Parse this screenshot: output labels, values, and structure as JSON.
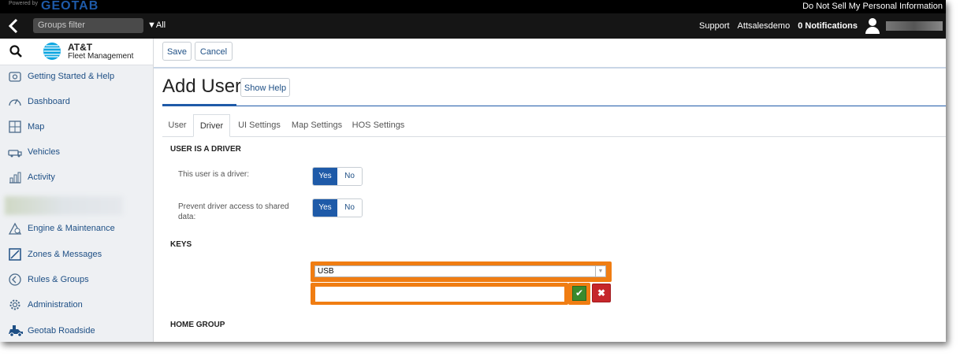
{
  "topbar": {
    "powered_by": "Powered by",
    "brand": "GEOTAB",
    "do_not_sell": "Do Not Sell My Personal Information"
  },
  "navbar": {
    "groups_filter_placeholder": "Groups filter",
    "all_label": "All",
    "support": "Support",
    "account": "Attsalesdemo",
    "notifications": "0 Notifications"
  },
  "sidebar": {
    "logo_line1": "AT&T",
    "logo_line2": "Fleet Management",
    "items": [
      {
        "label": "Getting Started & Help",
        "icon": "help-icon"
      },
      {
        "label": "Dashboard",
        "icon": "gauge-icon"
      },
      {
        "label": "Map",
        "icon": "map-icon"
      },
      {
        "label": "Vehicles",
        "icon": "vehicle-icon"
      },
      {
        "label": "Activity",
        "icon": "activity-icon"
      },
      {
        "label": "Engine & Maintenance",
        "icon": "engine-icon"
      },
      {
        "label": "Zones & Messages",
        "icon": "zones-icon"
      },
      {
        "label": "Rules & Groups",
        "icon": "rules-icon"
      },
      {
        "label": "Administration",
        "icon": "gear-icon"
      },
      {
        "label": "Geotab Roadside",
        "icon": "roadside-icon"
      }
    ]
  },
  "toolbar": {
    "save": "Save",
    "cancel": "Cancel"
  },
  "page": {
    "title": "Add User",
    "show_help": "Show Help"
  },
  "tabs": [
    "User",
    "Driver",
    "UI Settings",
    "Map Settings",
    "HOS Settings"
  ],
  "active_tab": "Driver",
  "driver": {
    "section_title": "USER IS A DRIVER",
    "is_driver_label": "This user is a driver:",
    "is_driver_value": "Yes",
    "prevent_label_line1": "Prevent driver access to shared",
    "prevent_label_line2": "data:",
    "prevent_value": "Yes",
    "yes": "Yes",
    "no": "No"
  },
  "keys": {
    "section_title": "KEYS",
    "type_selected": "USB",
    "key_value": ""
  },
  "home_group": {
    "section_title": "HOME GROUP"
  },
  "colors": {
    "accent": "#1e5aa8",
    "highlight": "#f07d12",
    "ok": "#3a8a2e",
    "delete": "#c6262a"
  }
}
